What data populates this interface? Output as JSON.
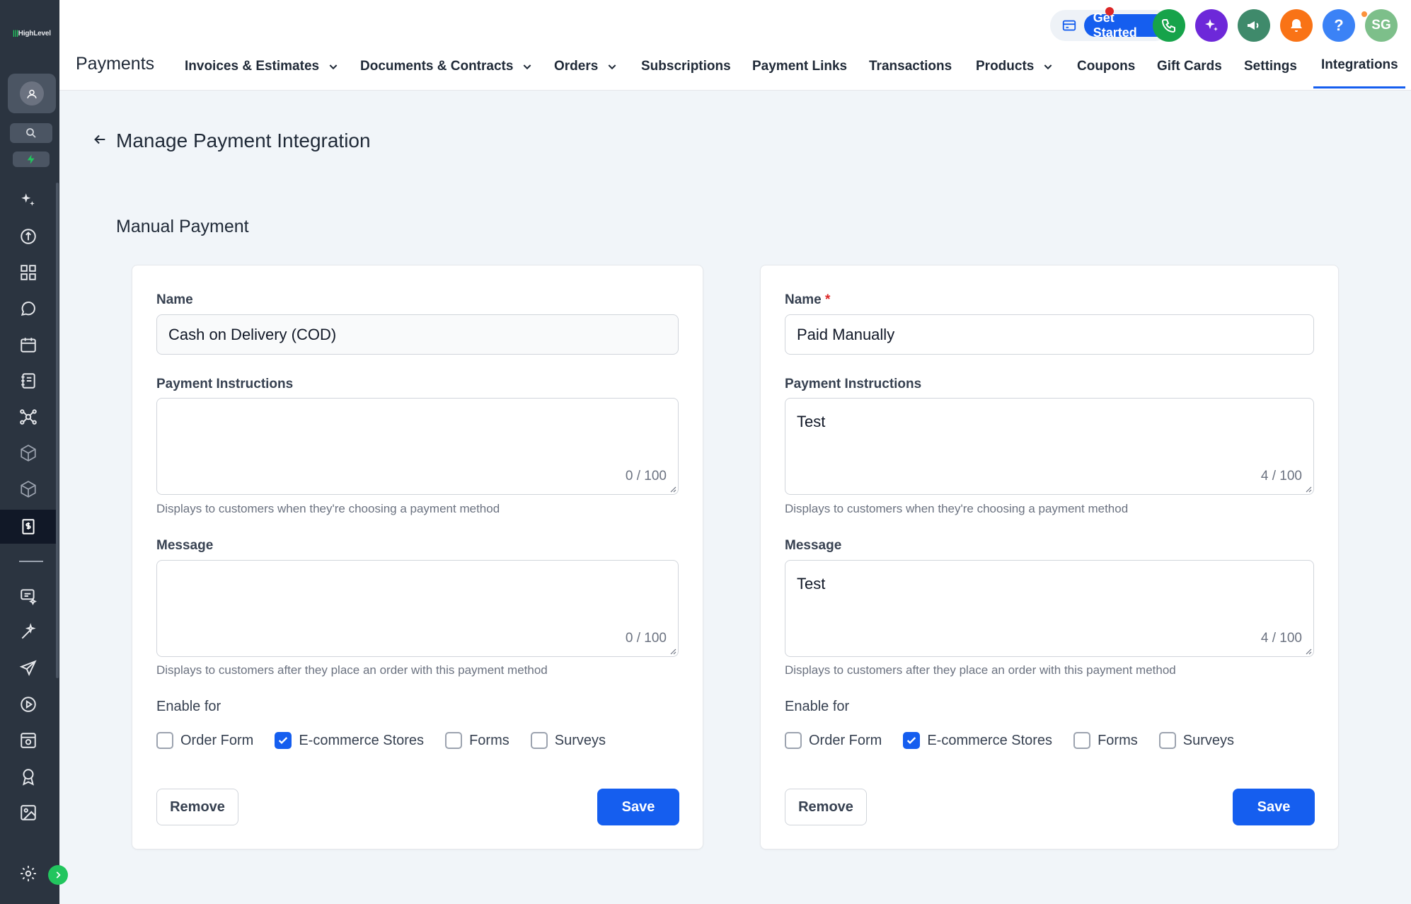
{
  "brand": {
    "logo_text": "HighLevel"
  },
  "header": {
    "app_title": "Payments",
    "get_started_label": "Get Started",
    "avatar_initials": "SG",
    "help_label": "?",
    "nav": [
      {
        "label": "Invoices & Estimates",
        "dropdown": true
      },
      {
        "label": "Documents & Contracts",
        "dropdown": true
      },
      {
        "label": "Orders",
        "dropdown": true
      },
      {
        "label": "Subscriptions",
        "dropdown": false
      },
      {
        "label": "Payment Links",
        "dropdown": false
      },
      {
        "label": "Transactions",
        "dropdown": false
      },
      {
        "label": "Products",
        "dropdown": true
      },
      {
        "label": "Coupons",
        "dropdown": false
      },
      {
        "label": "Gift Cards",
        "dropdown": false
      },
      {
        "label": "Settings",
        "dropdown": false
      },
      {
        "label": "Integrations",
        "dropdown": false,
        "active": true
      }
    ]
  },
  "page": {
    "title": "Manage Payment Integration",
    "section_title": "Manual Payment"
  },
  "cards": [
    {
      "name_label": "Name",
      "name_required": false,
      "name_value": "Cash on Delivery (COD)",
      "instructions_label": "Payment Instructions",
      "instructions_value": "",
      "instructions_count": "0 / 100",
      "instructions_help": "Displays to customers when they're choosing a payment method",
      "message_label": "Message",
      "message_value": "",
      "message_count": "0 / 100",
      "message_help": "Displays to customers after they place an order with this payment method",
      "enable_label": "Enable for",
      "options": [
        {
          "label": "Order Form",
          "checked": false
        },
        {
          "label": "E-commerce Stores",
          "checked": true
        },
        {
          "label": "Forms",
          "checked": false
        },
        {
          "label": "Surveys",
          "checked": false
        }
      ],
      "remove_label": "Remove",
      "save_label": "Save"
    },
    {
      "name_label": "Name",
      "name_required": true,
      "required_mark": "*",
      "name_value": "Paid Manually",
      "instructions_label": "Payment Instructions",
      "instructions_value": "Test",
      "instructions_count": "4 / 100",
      "instructions_help": "Displays to customers when they're choosing a payment method",
      "message_label": "Message",
      "message_value": "Test",
      "message_count": "4 / 100",
      "message_help": "Displays to customers after they place an order with this payment method",
      "enable_label": "Enable for",
      "options": [
        {
          "label": "Order Form",
          "checked": false
        },
        {
          "label": "E-commerce Stores",
          "checked": true
        },
        {
          "label": "Forms",
          "checked": false
        },
        {
          "label": "Surveys",
          "checked": false
        }
      ],
      "remove_label": "Remove",
      "save_label": "Save"
    }
  ],
  "colors": {
    "primary": "#155eef",
    "sidebar": "#2b3440",
    "phone": "#16a34a",
    "ai": "#6d28d9",
    "announce": "#3f8a6b",
    "notify": "#f97316",
    "help": "#3b82f6",
    "avatar": "#7dbf8a"
  }
}
